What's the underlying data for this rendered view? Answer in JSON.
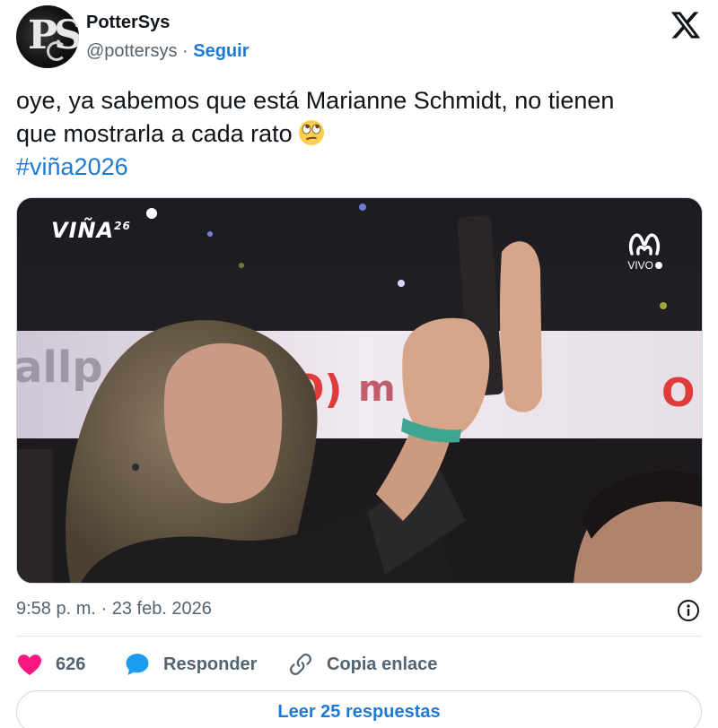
{
  "user": {
    "name": "PotterSys",
    "handle": "@pottersys",
    "separator": "·",
    "follow_label": "Seguir"
  },
  "tweet": {
    "line1": "oye, ya sabemos que está Marianne Schmidt, no tienen",
    "line2": "que mostrarla a cada rato",
    "hashtag": "#viña2026"
  },
  "media": {
    "show_logo": "VIÑA",
    "show_logo_sup": "26",
    "live_label": "VIVO"
  },
  "meta": {
    "timestamp": "9:58 p. m. · 23 feb. 2026"
  },
  "actions": {
    "likes_count": "626",
    "reply_label": "Responder",
    "copy_link_label": "Copia enlace"
  },
  "footer": {
    "read_replies_label": "Leer 25 respuestas"
  },
  "colors": {
    "link_blue": "#1d7ad3",
    "like_pink": "#f91880",
    "secondary_text": "#536471"
  },
  "icons": [
    "avatar",
    "x-logo-icon",
    "rolling-eyes-emoji",
    "mega-logo-icon",
    "info-icon",
    "heart-icon",
    "reply-bubble-icon",
    "link-icon"
  ]
}
